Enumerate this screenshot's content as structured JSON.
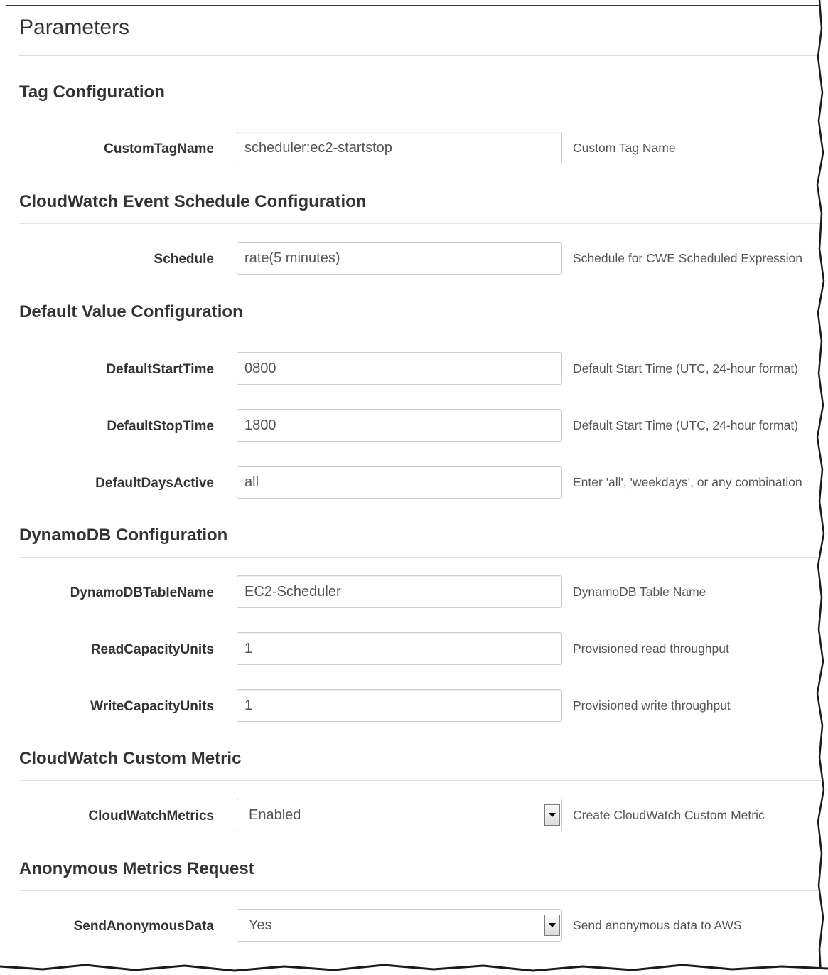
{
  "page_title": "Parameters",
  "sections": [
    {
      "title": "Tag Configuration",
      "params": [
        {
          "label": "CustomTagName",
          "value": "scheduler:ec2-startstop",
          "help": "Custom Tag Name"
        }
      ]
    },
    {
      "title": "CloudWatch Event Schedule Configuration",
      "params": [
        {
          "label": "Schedule",
          "value": "rate(5 minutes)",
          "help": "Schedule for CWE Scheduled Expression"
        }
      ]
    },
    {
      "title": "Default Value Configuration",
      "params": [
        {
          "label": "DefaultStartTime",
          "value": "0800",
          "help": "Default Start Time (UTC, 24-hour format)"
        },
        {
          "label": "DefaultStopTime",
          "value": "1800",
          "help": "Default Start Time (UTC, 24-hour format)"
        },
        {
          "label": "DefaultDaysActive",
          "value": "all",
          "help": "Enter 'all', 'weekdays', or any combination"
        }
      ]
    },
    {
      "title": "DynamoDB Configuration",
      "params": [
        {
          "label": "DynamoDBTableName",
          "value": "EC2-Scheduler",
          "help": "DynamoDB Table Name"
        },
        {
          "label": "ReadCapacityUnits",
          "value": "1",
          "help": "Provisioned read throughput"
        },
        {
          "label": "WriteCapacityUnits",
          "value": "1",
          "help": "Provisioned write throughput"
        }
      ]
    },
    {
      "title": "CloudWatch Custom Metric",
      "params": [
        {
          "label": "CloudWatchMetrics",
          "value": "Enabled",
          "help": "Create CloudWatch Custom Metric"
        }
      ]
    },
    {
      "title": "Anonymous Metrics Request",
      "params": [
        {
          "label": "SendAnonymousData",
          "value": "Yes",
          "help": "Send anonymous data to AWS"
        }
      ]
    }
  ]
}
